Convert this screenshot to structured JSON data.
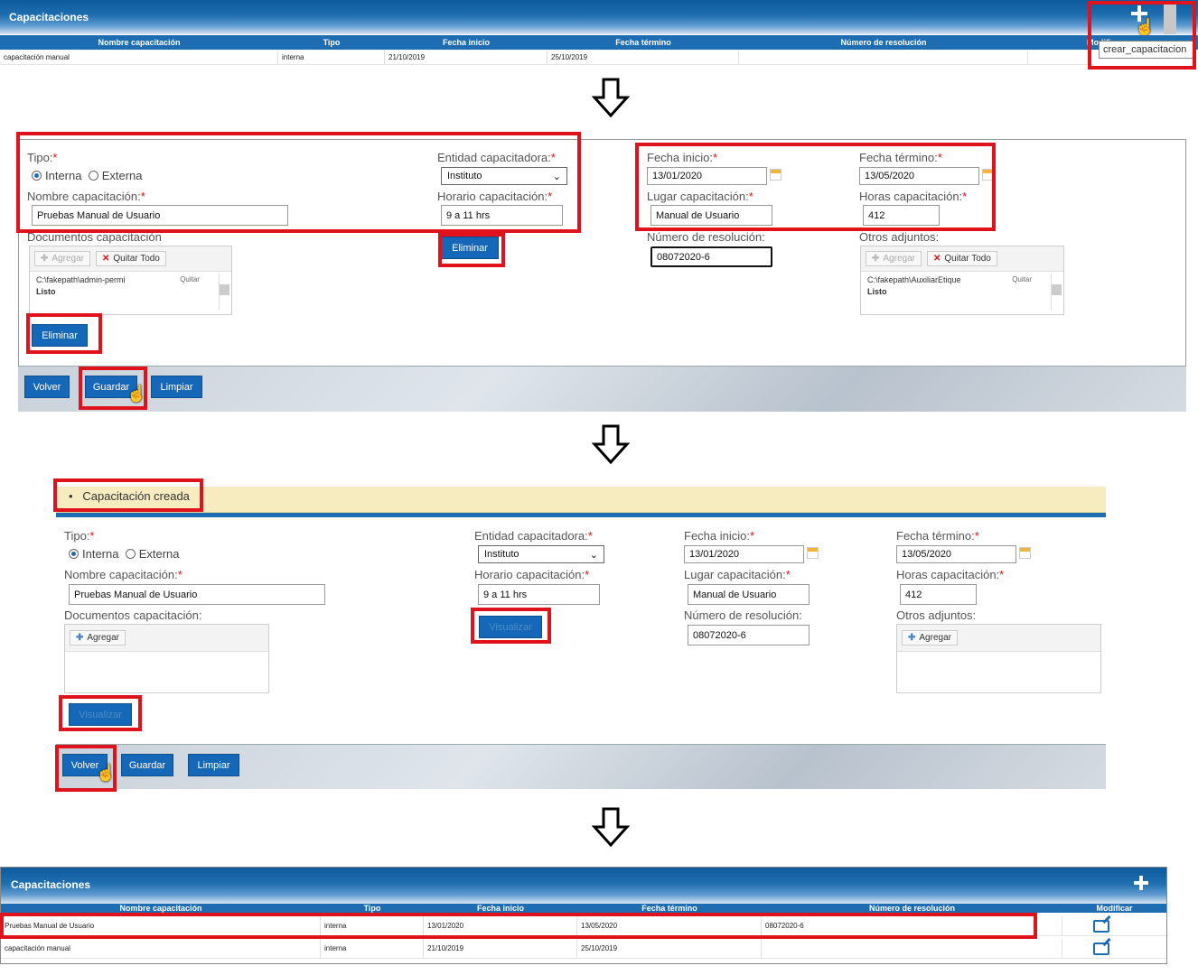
{
  "panel1": {
    "title": "Capacitaciones",
    "tooltip": "crear_capacitacion",
    "columns": [
      "Nombre capacitación",
      "Tipo",
      "Fecha inicio",
      "Fecha término",
      "Número de resolución",
      "Modificar"
    ],
    "rows": [
      {
        "nombre": "capacitación manual",
        "tipo": "interna",
        "inicio": "21/10/2019",
        "termino": "25/10/2019",
        "resolucion": ""
      }
    ]
  },
  "form1": {
    "tipo_label": "Tipo:",
    "interna": "Interna",
    "externa": "Externa",
    "nombre_label": "Nombre capacitación:",
    "nombre_value": "Pruebas Manual de Usuario",
    "entidad_label": "Entidad capacitadora:",
    "entidad_value": "Instituto",
    "horario_label": "Horario capacitación:",
    "horario_value": "9 a 11 hrs",
    "fecha_inicio_label": "Fecha inicio:",
    "fecha_inicio_value": "13/01/2020",
    "fecha_termino_label": "Fecha término:",
    "fecha_termino_value": "13/05/2020",
    "lugar_label": "Lugar capacitación:",
    "lugar_value": "Manual de Usuario",
    "horas_label": "Horas capacitación:",
    "horas_value": "412",
    "docs_label": "Documentos capacitación",
    "resolucion_label": "Número de resolución:",
    "resolucion_value": "08072020-6",
    "otros_label": "Otros adjuntos:",
    "agregar": "Agregar",
    "quitar_todo": "Quitar Todo",
    "quitar": "Quitar",
    "doc_file": "C:\\fakepath\\admin-permi",
    "otros_file": "C:\\fakepath\\AuxiliarEtique",
    "listo": "Listo",
    "eliminar": "Eliminar",
    "volver": "Volver",
    "guardar": "Guardar",
    "limpiar": "Limpiar"
  },
  "form2": {
    "message": "Capacitación creada",
    "visualizar": "Visualizar"
  },
  "panel2": {
    "title": "Capacitaciones",
    "rows": [
      {
        "nombre": "Pruebas Manual de Usuario",
        "tipo": "interna",
        "inicio": "13/01/2020",
        "termino": "13/05/2020",
        "resolucion": "08072020-6"
      },
      {
        "nombre": "capacitación manual",
        "tipo": "interna",
        "inicio": "21/10/2019",
        "termino": "25/10/2019",
        "resolucion": ""
      }
    ]
  },
  "colors": {
    "accent": "#1567b7",
    "highlight": "#e0121b",
    "message_bg": "#f7ebc0"
  }
}
